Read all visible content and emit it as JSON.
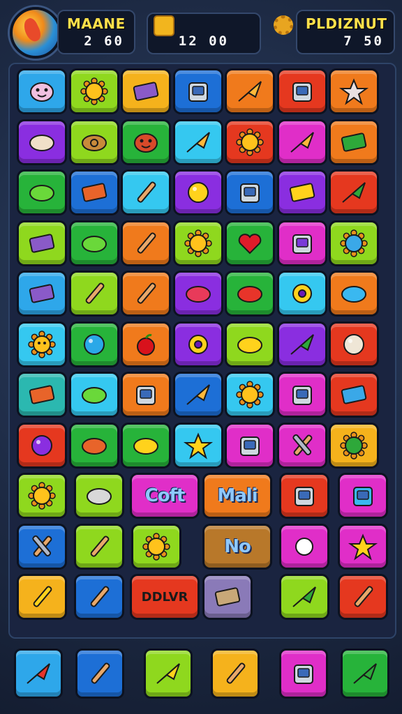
{
  "hud": {
    "left_panel": {
      "title": "MAANE",
      "value": "2  60"
    },
    "center_panel": {
      "value": "12 00"
    },
    "right_panel": {
      "title": "PLDIZNUT",
      "value": "7  50"
    }
  },
  "tile_colors": {
    "blue": "#2ea7ea",
    "lime": "#8fd81e",
    "yellow": "#f5b21c",
    "darkblue": "#1d6fd6",
    "orange": "#f07a1c",
    "red": "#e5381f",
    "purple": "#8a2ee0",
    "magenta": "#e02ec8",
    "green": "#27b33a",
    "teal": "#2bb8b0",
    "cyan": "#35c8f0",
    "slate": "#8a7ab8",
    "brown": "#b8782a"
  },
  "board": {
    "rows": [
      [
        "face-icon:blue",
        "sun-gear-icon:lime",
        "book-icon:yellow",
        "robot-icon:darkblue",
        "rocket-icon:orange",
        "radio-icon:red",
        "star-badge-icon:orange"
      ],
      [
        "speech-bubble-icon:purple",
        "target-icon:lime",
        "frog-face-icon:green",
        "paper-plane-icon:cyan",
        "gear-icon:red",
        "rocket-ship-icon:magenta",
        "cube-icon:orange"
      ],
      [
        "ufo-icon:green",
        "chip-icon:darkblue",
        "wrench-icon:cyan",
        "blob-icon:purple",
        "camera-icon:darkblue",
        "tag-icon:purple",
        "leaf-arrow-icon:red"
      ],
      [
        "chest-icon:lime",
        "saturn-icon:green",
        "flashlight-icon:orange",
        "gear-icon:lime",
        "heart-icon:green",
        "tv-icon:magenta",
        "mirror-icon:lime"
      ],
      [
        "book-icon:blue",
        "ruler-icon:lime",
        "pencil-icon:orange",
        "crab-icon:purple",
        "hook-icon:green",
        "ring-icon:cyan",
        "number-seven-icon:orange"
      ],
      [
        "sun-face-icon:cyan",
        "sphere-icon:green",
        "apple-icon:orange",
        "donut-icon:purple",
        "lemon-icon:lime",
        "leaf-icon:purple",
        "ball-icon:red"
      ],
      [
        "envelope-icon:teal",
        "splat-icon:cyan",
        "jar-icon:orange",
        "cone-icon:darkblue",
        "sunflower-icon:cyan",
        "trash-icon:magenta",
        "eraser-icon:red"
      ],
      [
        "planet-icon:red",
        "bowl-icon:green",
        "bean-icon:green",
        "starfish-icon:cyan",
        "battery-icon:magenta",
        "scissors-icon:magenta",
        "virus-icon:yellow"
      ],
      [
        "sun-icon:lime",
        "helmet-icon:lime",
        "text-tile:magenta",
        "text-tile:orange",
        "robot-box-icon:red",
        "bucket-icon:magenta"
      ],
      [
        "crossed-swords-icon:darkblue",
        "whistle-icon:lime",
        "gear-icon:lime",
        "text-tile:brown",
        "gem-icon:magenta",
        "star-icon:magenta"
      ],
      [
        "banana-icon:yellow",
        "brush-icon:darkblue",
        "text-tile:red",
        "sandwich-icon:slate",
        "leaf-plane-icon:lime",
        "hammer-icon:red"
      ]
    ],
    "labels": {
      "coft": "Coft",
      "mali": "Mali",
      "no": "No",
      "ddlvr": "DDLVR"
    }
  },
  "tray": [
    "arrow-icon:blue",
    "pencil-icon:darkblue",
    "crown-icon:lime",
    "feather-icon:yellow",
    "camera-icon:magenta",
    "leaf-icon:green"
  ]
}
